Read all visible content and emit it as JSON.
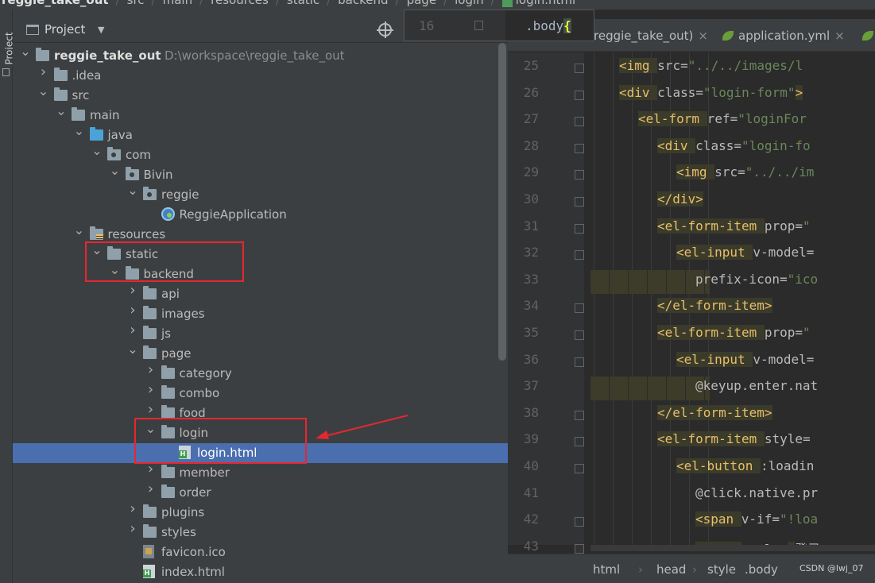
{
  "breadcrumb": [
    "reggie_take_out",
    "src",
    "main",
    "resources",
    "static",
    "backend",
    "page",
    "login",
    "login.html"
  ],
  "left_strip": {
    "label": "Project"
  },
  "project_panel": {
    "title": "Project",
    "tree": [
      {
        "label": "reggie_take_out",
        "path": "D:\\workspace\\reggie_take_out",
        "icon": "folder-icon",
        "arrow": "down",
        "depth": 0,
        "bold": true
      },
      {
        "label": ".idea",
        "icon": "folder-icon",
        "arrow": "right",
        "depth": 1
      },
      {
        "label": "src",
        "icon": "folder-icon",
        "arrow": "down",
        "depth": 1
      },
      {
        "label": "main",
        "icon": "folder-icon",
        "arrow": "down",
        "depth": 2
      },
      {
        "label": "java",
        "icon": "source-folder-icon",
        "arrow": "down",
        "depth": 3
      },
      {
        "label": "com",
        "icon": "package-icon",
        "arrow": "down",
        "depth": 4
      },
      {
        "label": "Bivin",
        "icon": "package-icon",
        "arrow": "down",
        "depth": 5
      },
      {
        "label": "reggie",
        "icon": "package-icon",
        "arrow": "down",
        "depth": 6
      },
      {
        "label": "ReggieApplication",
        "icon": "spring-boot-icon",
        "arrow": "",
        "depth": 7
      },
      {
        "label": "resources",
        "icon": "resources-folder-icon",
        "arrow": "down",
        "depth": 3
      },
      {
        "label": "static",
        "icon": "folder-icon",
        "arrow": "down",
        "depth": 4
      },
      {
        "label": "backend",
        "icon": "folder-icon",
        "arrow": "down",
        "depth": 5
      },
      {
        "label": "api",
        "icon": "folder-icon",
        "arrow": "right",
        "depth": 6
      },
      {
        "label": "images",
        "icon": "folder-icon",
        "arrow": "right",
        "depth": 6
      },
      {
        "label": "js",
        "icon": "folder-icon",
        "arrow": "right",
        "depth": 6
      },
      {
        "label": "page",
        "icon": "folder-icon",
        "arrow": "down",
        "depth": 6
      },
      {
        "label": "category",
        "icon": "folder-icon",
        "arrow": "right",
        "depth": 7
      },
      {
        "label": "combo",
        "icon": "folder-icon",
        "arrow": "right",
        "depth": 7
      },
      {
        "label": "food",
        "icon": "folder-icon",
        "arrow": "right",
        "depth": 7
      },
      {
        "label": "login",
        "icon": "folder-icon",
        "arrow": "down",
        "depth": 7
      },
      {
        "label": "login.html",
        "icon": "html-file-icon",
        "arrow": "",
        "depth": 8,
        "selected": true
      },
      {
        "label": "member",
        "icon": "folder-icon",
        "arrow": "right",
        "depth": 7
      },
      {
        "label": "order",
        "icon": "folder-icon",
        "arrow": "right",
        "depth": 7
      },
      {
        "label": "plugins",
        "icon": "folder-icon",
        "arrow": "right",
        "depth": 6
      },
      {
        "label": "styles",
        "icon": "folder-icon",
        "arrow": "right",
        "depth": 6
      },
      {
        "label": "favicon.ico",
        "icon": "ico-file-icon",
        "arrow": "",
        "depth": 6
      },
      {
        "label": "index.html",
        "icon": "html-file-icon",
        "arrow": "",
        "depth": 6
      }
    ]
  },
  "editor": {
    "tabs": [
      {
        "label": "reggie_take_out)",
        "close": "×"
      },
      {
        "label": "application.yml",
        "close": "×"
      }
    ],
    "sticky": {
      "line": "16",
      "code": ".body",
      "brace": "{"
    },
    "lines": [
      {
        "num": "25",
        "indent": 3,
        "tokens": [
          [
            "tag",
            "<img "
          ],
          [
            "attr",
            "src="
          ],
          [
            "str",
            "\"../../images/l"
          ]
        ]
      },
      {
        "num": "26",
        "indent": 3,
        "tokens": [
          [
            "tag",
            "<div "
          ],
          [
            "attr",
            "class="
          ],
          [
            "str",
            "\"login-form\""
          ],
          [
            "tag",
            ">"
          ]
        ]
      },
      {
        "num": "27",
        "indent": 4,
        "tokens": [
          [
            "tag",
            "<el-form "
          ],
          [
            "attr",
            "ref="
          ],
          [
            "str",
            "\"loginFor"
          ]
        ]
      },
      {
        "num": "28",
        "indent": 5,
        "tokens": [
          [
            "tag",
            "<div "
          ],
          [
            "attr",
            "class="
          ],
          [
            "str",
            "\"login-fo"
          ]
        ]
      },
      {
        "num": "29",
        "indent": 6,
        "tokens": [
          [
            "tag",
            "<img "
          ],
          [
            "attr",
            "src="
          ],
          [
            "str",
            "\"../../im"
          ]
        ]
      },
      {
        "num": "30",
        "indent": 5,
        "tokens": [
          [
            "tag",
            "</div>"
          ]
        ]
      },
      {
        "num": "31",
        "indent": 5,
        "tokens": [
          [
            "tag",
            "<el-form-item "
          ],
          [
            "attr",
            "prop="
          ],
          [
            "str",
            "\""
          ]
        ]
      },
      {
        "num": "32",
        "indent": 6,
        "tokens": [
          [
            "tag",
            "<el-input "
          ],
          [
            "attr",
            "v-model="
          ]
        ]
      },
      {
        "num": "33",
        "indent": 7,
        "tokens": [
          [
            "attr",
            "prefix-icon="
          ],
          [
            "str",
            "\"ico"
          ]
        ]
      },
      {
        "num": "34",
        "indent": 5,
        "tokens": [
          [
            "tag",
            "</el-form-item>"
          ]
        ]
      },
      {
        "num": "35",
        "indent": 5,
        "tokens": [
          [
            "tag",
            "<el-form-item "
          ],
          [
            "attr",
            "prop="
          ],
          [
            "str",
            "\""
          ]
        ]
      },
      {
        "num": "36",
        "indent": 6,
        "tokens": [
          [
            "tag",
            "<el-input "
          ],
          [
            "attr",
            "v-model="
          ]
        ]
      },
      {
        "num": "37",
        "indent": 7,
        "tokens": [
          [
            "attr",
            "@keyup.enter.nat"
          ]
        ]
      },
      {
        "num": "38",
        "indent": 5,
        "tokens": [
          [
            "tag",
            "</el-form-item>"
          ]
        ]
      },
      {
        "num": "39",
        "indent": 5,
        "tokens": [
          [
            "tag",
            "<el-form-item "
          ],
          [
            "attr",
            "style="
          ]
        ]
      },
      {
        "num": "40",
        "indent": 6,
        "tokens": [
          [
            "tag",
            "<el-button "
          ],
          [
            "attr",
            ":loadin"
          ]
        ]
      },
      {
        "num": "41",
        "indent": 7,
        "tokens": [
          [
            "attr",
            "@click.native.pr"
          ]
        ]
      },
      {
        "num": "42",
        "indent": 7,
        "tokens": [
          [
            "tag",
            "<span "
          ],
          [
            "attr",
            "v-if="
          ],
          [
            "str",
            "\"!loa"
          ]
        ]
      },
      {
        "num": "43",
        "indent": 7,
        "tokens": [
          [
            "tag",
            "<span "
          ],
          [
            "attr",
            "v-else"
          ],
          [
            "tag",
            ">"
          ],
          [
            "txt",
            "登录"
          ]
        ]
      }
    ]
  },
  "statusbar": {
    "crumbs": [
      "html",
      "head",
      "style",
      ".body"
    ],
    "watermark": "CSDN @lwj_07"
  }
}
